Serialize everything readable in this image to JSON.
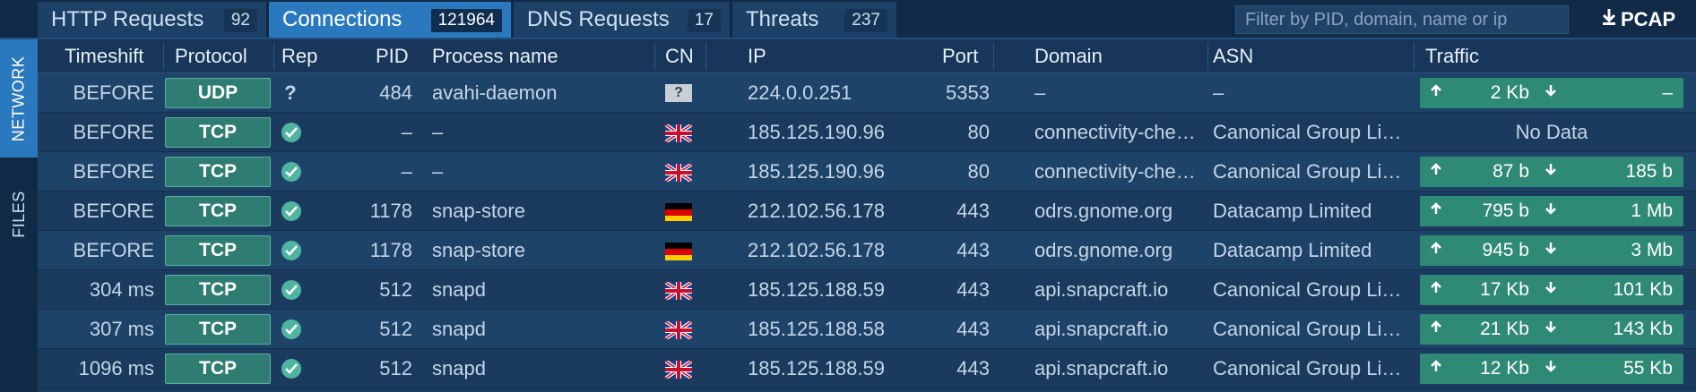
{
  "tabs": [
    {
      "label": "HTTP Requests",
      "count": "92"
    },
    {
      "label": "Connections",
      "count": "121964"
    },
    {
      "label": "DNS Requests",
      "count": "17"
    },
    {
      "label": "Threats",
      "count": "237"
    }
  ],
  "filter": {
    "placeholder": "Filter by PID, domain, name or ip",
    "value": ""
  },
  "pcap": {
    "label": "PCAP",
    "icon": "download-icon"
  },
  "side_tabs": [
    {
      "label": "NETWORK",
      "active": true
    },
    {
      "label": "FILES",
      "active": false
    }
  ],
  "columns": {
    "timeshift": "Timeshift",
    "protocol": "Protocol",
    "rep": "Rep",
    "pid": "PID",
    "process": "Process name",
    "cn": "CN",
    "ip": "IP",
    "port": "Port",
    "domain": "Domain",
    "asn": "ASN",
    "traffic": "Traffic"
  },
  "rows": [
    {
      "timeshift": "BEFORE",
      "protocol": "UDP",
      "rep": "unknown",
      "rep_symbol": "?",
      "pid": "484",
      "process": "avahi-daemon",
      "cn": "unknown",
      "cn_symbol": "?",
      "ip": "224.0.0.251",
      "port": "5353",
      "domain": "–",
      "asn": "–",
      "traffic_up": "2 Kb",
      "traffic_down": "–",
      "no_data": ""
    },
    {
      "timeshift": "BEFORE",
      "protocol": "TCP",
      "rep": "ok",
      "pid": "–",
      "process": "–",
      "cn": "gb",
      "ip": "185.125.190.96",
      "port": "80",
      "domain": "connectivity-che…",
      "asn": "Canonical Group Li…",
      "traffic_up": "",
      "traffic_down": "",
      "no_data": "No Data"
    },
    {
      "timeshift": "BEFORE",
      "protocol": "TCP",
      "rep": "ok",
      "pid": "–",
      "process": "–",
      "cn": "gb",
      "ip": "185.125.190.96",
      "port": "80",
      "domain": "connectivity-che…",
      "asn": "Canonical Group Li…",
      "traffic_up": "87 b",
      "traffic_down": "185 b",
      "no_data": ""
    },
    {
      "timeshift": "BEFORE",
      "protocol": "TCP",
      "rep": "ok",
      "pid": "1178",
      "process": "snap-store",
      "cn": "de",
      "ip": "212.102.56.178",
      "port": "443",
      "domain": "odrs.gnome.org",
      "asn": "Datacamp Limited",
      "traffic_up": "795 b",
      "traffic_down": "1 Mb",
      "no_data": ""
    },
    {
      "timeshift": "BEFORE",
      "protocol": "TCP",
      "rep": "ok",
      "pid": "1178",
      "process": "snap-store",
      "cn": "de",
      "ip": "212.102.56.178",
      "port": "443",
      "domain": "odrs.gnome.org",
      "asn": "Datacamp Limited",
      "traffic_up": "945 b",
      "traffic_down": "3 Mb",
      "no_data": ""
    },
    {
      "timeshift": "304 ms",
      "protocol": "TCP",
      "rep": "ok",
      "pid": "512",
      "process": "snapd",
      "cn": "gb",
      "ip": "185.125.188.59",
      "port": "443",
      "domain": "api.snapcraft.io",
      "asn": "Canonical Group Li…",
      "traffic_up": "17 Kb",
      "traffic_down": "101 Kb",
      "no_data": ""
    },
    {
      "timeshift": "307 ms",
      "protocol": "TCP",
      "rep": "ok",
      "pid": "512",
      "process": "snapd",
      "cn": "gb",
      "ip": "185.125.188.58",
      "port": "443",
      "domain": "api.snapcraft.io",
      "asn": "Canonical Group Li…",
      "traffic_up": "21 Kb",
      "traffic_down": "143 Kb",
      "no_data": ""
    },
    {
      "timeshift": "1096 ms",
      "protocol": "TCP",
      "rep": "ok",
      "pid": "512",
      "process": "snapd",
      "cn": "gb",
      "ip": "185.125.188.59",
      "port": "443",
      "domain": "api.snapcraft.io",
      "asn": "Canonical Group Li…",
      "traffic_up": "12 Kb",
      "traffic_down": "55 Kb",
      "no_data": ""
    }
  ],
  "colors": {
    "active_tab": "#2a79bf",
    "protocol_badge": "#2f7d72",
    "traffic_bar": "#2f8a75",
    "rep_ok": "#4fb5a1"
  }
}
